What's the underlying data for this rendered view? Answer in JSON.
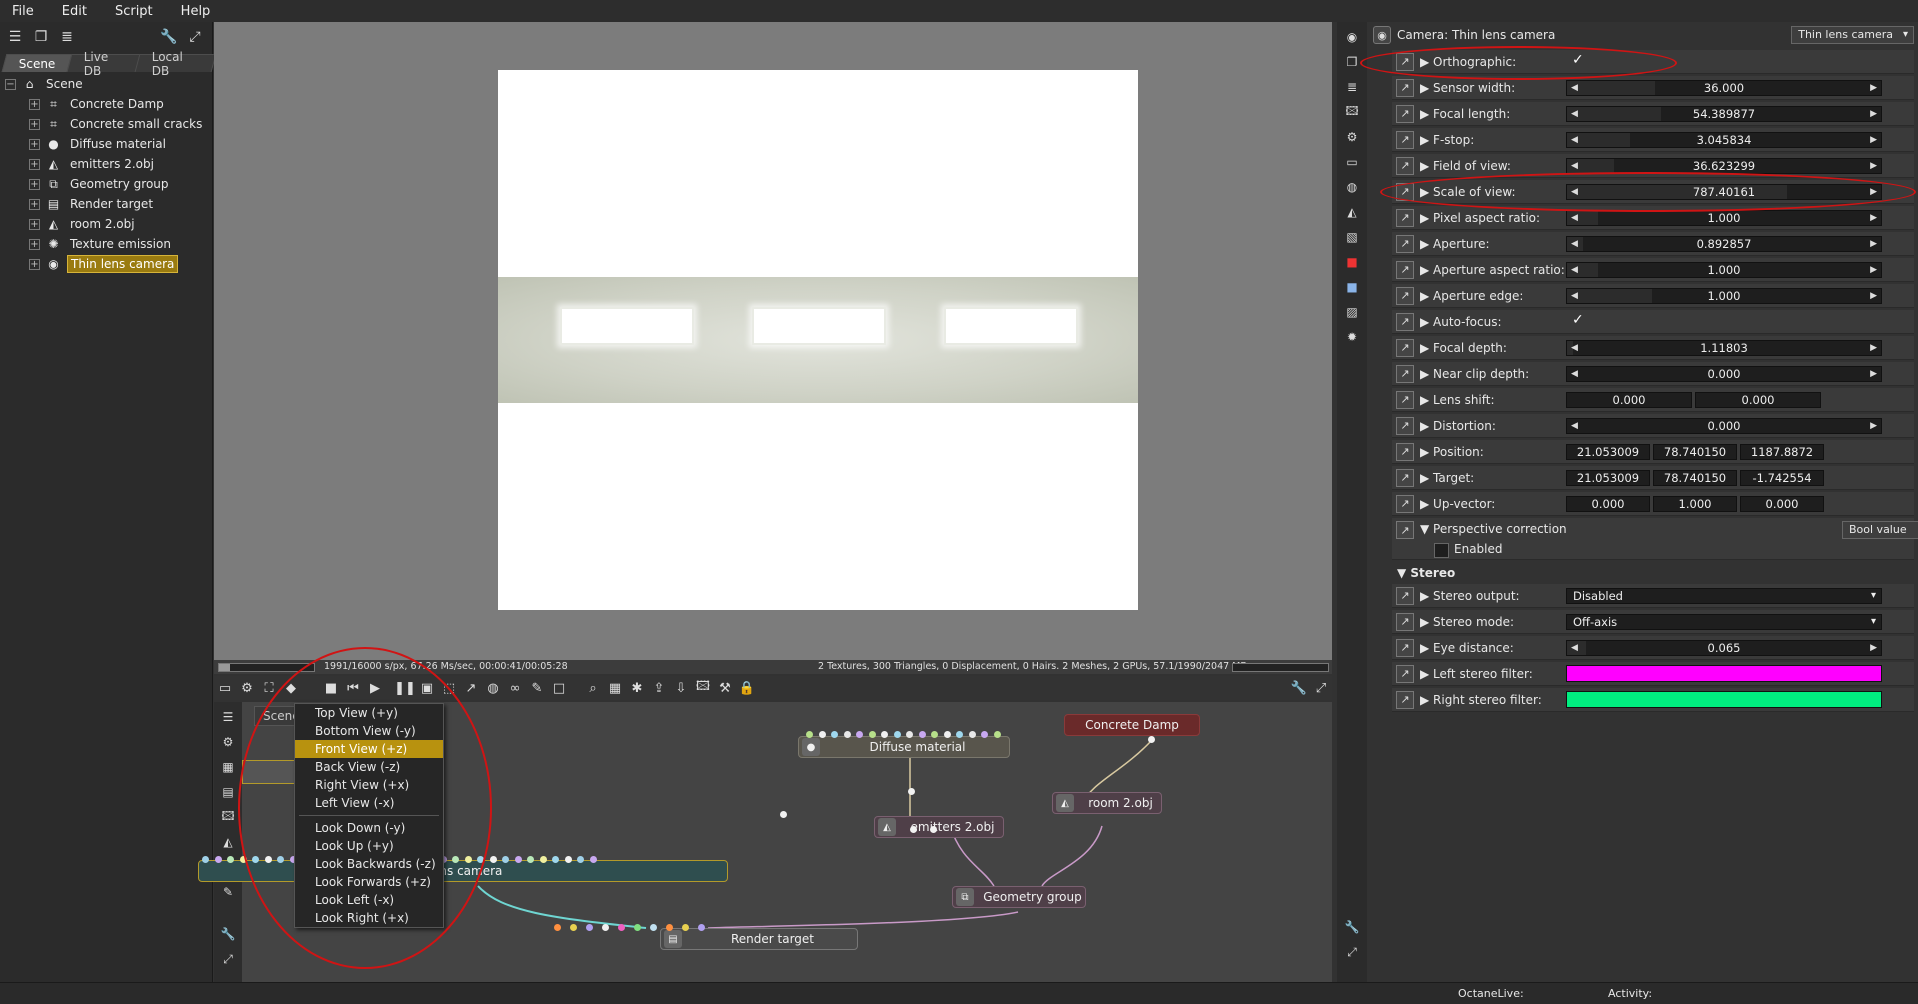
{
  "menu": [
    "File",
    "Edit",
    "Script",
    "Help"
  ],
  "scene_tabs": [
    "Scene",
    "Live DB",
    "Local DB"
  ],
  "scene_tree": {
    "root": "Scene",
    "items": [
      {
        "label": "Concrete Damp",
        "icon": "texture-icon"
      },
      {
        "label": "Concrete small cracks",
        "icon": "texture-icon"
      },
      {
        "label": "Diffuse material",
        "icon": "material-sphere-icon"
      },
      {
        "label": "emitters 2.obj",
        "icon": "mesh-icon"
      },
      {
        "label": "Geometry group",
        "icon": "geometry-group-icon"
      },
      {
        "label": "Render target",
        "icon": "render-target-icon"
      },
      {
        "label": "room 2.obj",
        "icon": "mesh-icon"
      },
      {
        "label": "Texture emission",
        "icon": "emission-icon"
      },
      {
        "label": "Thin lens camera",
        "icon": "camera-icon",
        "selected": true
      }
    ]
  },
  "status": {
    "left": "1991/16000 s/px, 67.26 Ms/sec, 00:00:41/00:05:28",
    "right": "2 Textures, 300 Triangles, 0 Displacement, 0 Hairs. 2 Meshes, 2 GPUs, 57.1/1990/2047 MB",
    "progress": 0.12
  },
  "graph": {
    "tab": "Scene",
    "nodes": [
      {
        "id": "diffuse",
        "label": "Diffuse material"
      },
      {
        "id": "concrete",
        "label": "Concrete Damp"
      },
      {
        "id": "emitters",
        "label": "emitters 2.obj"
      },
      {
        "id": "room",
        "label": "room 2.obj"
      },
      {
        "id": "geogroup",
        "label": "Geometry group"
      },
      {
        "id": "camera",
        "label": "Thin lens camera"
      },
      {
        "id": "rendertarget",
        "label": "Render target"
      }
    ]
  },
  "context_menu": {
    "items": [
      {
        "label": "Top View (+y)"
      },
      {
        "label": "Bottom View (-y)"
      },
      {
        "label": "Front View (+z)",
        "highlighted": true
      },
      {
        "label": "Back View (-z)"
      },
      {
        "label": "Right View (+x)"
      },
      {
        "label": "Left View (-x)"
      }
    ],
    "items2": [
      {
        "label": "Look Down (-y)"
      },
      {
        "label": "Look Up (+y)"
      },
      {
        "label": "Look Backwards (-z)"
      },
      {
        "label": "Look Forwards (+z)"
      },
      {
        "label": "Look Left (-x)"
      },
      {
        "label": "Look Right (+x)"
      }
    ]
  },
  "inspector": {
    "title": "Camera: Thin lens camera",
    "type_dropdown": "Thin lens camera",
    "params": [
      {
        "label": "Orthographic:",
        "kind": "check",
        "checked": true
      },
      {
        "label": "Sensor width:",
        "kind": "slider",
        "value": "36.000",
        "fill": 0.28
      },
      {
        "label": "Focal length:",
        "kind": "slider",
        "value": "54.389877",
        "fill": 0.3
      },
      {
        "label": "F-stop:",
        "kind": "slider",
        "value": "3.045834",
        "fill": 0.2
      },
      {
        "label": "Field of view:",
        "kind": "slider",
        "value": "36.623299",
        "fill": 0.15
      },
      {
        "label": "Scale of view:",
        "kind": "slider",
        "value": "787.40161",
        "fill": 0.7
      },
      {
        "label": "Pixel aspect ratio:",
        "kind": "slider",
        "value": "1.000",
        "fill": 0.1
      },
      {
        "label": "Aperture:",
        "kind": "slider",
        "value": "0.892857",
        "fill": 0.05
      },
      {
        "label": "Aperture aspect ratio:",
        "kind": "slider",
        "value": "1.000",
        "fill": 0.1
      },
      {
        "label": "Aperture edge:",
        "kind": "slider",
        "value": "1.000",
        "fill": 0.27
      },
      {
        "label": "Auto-focus:",
        "kind": "check",
        "checked": true
      },
      {
        "label": "Focal depth:",
        "kind": "slider",
        "value": "1.11803",
        "fill": 0.02
      },
      {
        "label": "Near clip depth:",
        "kind": "slider",
        "value": "0.000",
        "fill": 0.0
      },
      {
        "label": "Lens shift:",
        "kind": "boxes2",
        "values": [
          "0.000",
          "0.000"
        ]
      },
      {
        "label": "Distortion:",
        "kind": "slider",
        "value": "0.000",
        "fill": 0.0
      },
      {
        "label": "Position:",
        "kind": "boxes3",
        "values": [
          "21.053009",
          "78.740150",
          "1187.8872"
        ]
      },
      {
        "label": "Target:",
        "kind": "boxes3",
        "values": [
          "21.053009",
          "78.740150",
          "-1.742554"
        ]
      },
      {
        "label": "Up-vector:",
        "kind": "boxes3",
        "values": [
          "0.000",
          "1.000",
          "0.000"
        ]
      }
    ],
    "perspective": {
      "label": "Perspective correction",
      "dropdown": "Bool value",
      "enabled_label": "Enabled"
    },
    "stereo": {
      "section": "Stereo",
      "params": [
        {
          "label": "Stereo output:",
          "kind": "dropdown",
          "value": "Disabled"
        },
        {
          "label": "Stereo mode:",
          "kind": "dropdown",
          "value": "Off-axis"
        },
        {
          "label": "Eye distance:",
          "kind": "slider",
          "value": "0.065",
          "fill": 0.06
        },
        {
          "label": "Left stereo filter:",
          "kind": "color",
          "color": "#ff00ff"
        },
        {
          "label": "Right stereo filter:",
          "kind": "color",
          "color": "#00ee80"
        }
      ]
    }
  },
  "bottom_status": {
    "octanelive": "OctaneLive:",
    "activity": "Activity:"
  }
}
